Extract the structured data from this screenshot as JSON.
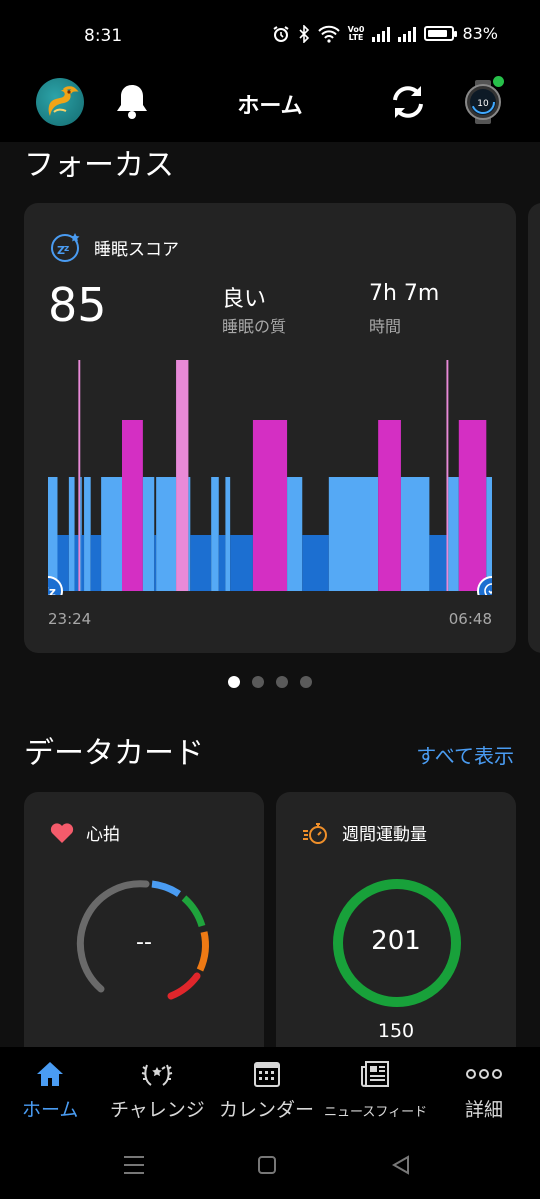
{
  "status_bar": {
    "time": "8:31",
    "battery": "83%",
    "battery_level": 0.83,
    "volte_label": "Vo0 LTE"
  },
  "header": {
    "title": "ホーム"
  },
  "focus": {
    "section_title": "フォーカス",
    "sleep_card": {
      "title": "睡眠スコア",
      "score": "85",
      "quality_value": "良い",
      "quality_label": "睡眠の質",
      "duration_value": "7h 7m",
      "duration_label": "時間",
      "start_time": "23:24",
      "end_time": "06:48"
    },
    "pager": {
      "pages": 4,
      "active": 0
    }
  },
  "data_cards": {
    "section_title": "データカード",
    "see_all": "すべて表示",
    "heart_rate": {
      "title": "心拍",
      "value": "--"
    },
    "weekly_activity": {
      "title": "週間運動量",
      "value": "201",
      "goal": "150",
      "progress": 1.0
    }
  },
  "colors": {
    "accent": "#4a9cf2",
    "deep_sleep": "#1c6fd1",
    "light_sleep": "#55a9f5",
    "rem_sleep": "#d42fc3",
    "awake": "#e88ad8",
    "activity_ring": "#18a13a"
  },
  "bottom_nav": {
    "items": [
      {
        "label": "ホーム",
        "icon": "home-icon",
        "active": true
      },
      {
        "label": "チャレンジ",
        "icon": "laurel-icon",
        "active": false
      },
      {
        "label": "カレンダー",
        "icon": "calendar-icon",
        "active": false
      },
      {
        "label": "ニュースフィード",
        "icon": "newsfeed-icon",
        "active": false
      },
      {
        "label": "詳細",
        "icon": "more-icon",
        "active": false
      }
    ]
  }
}
